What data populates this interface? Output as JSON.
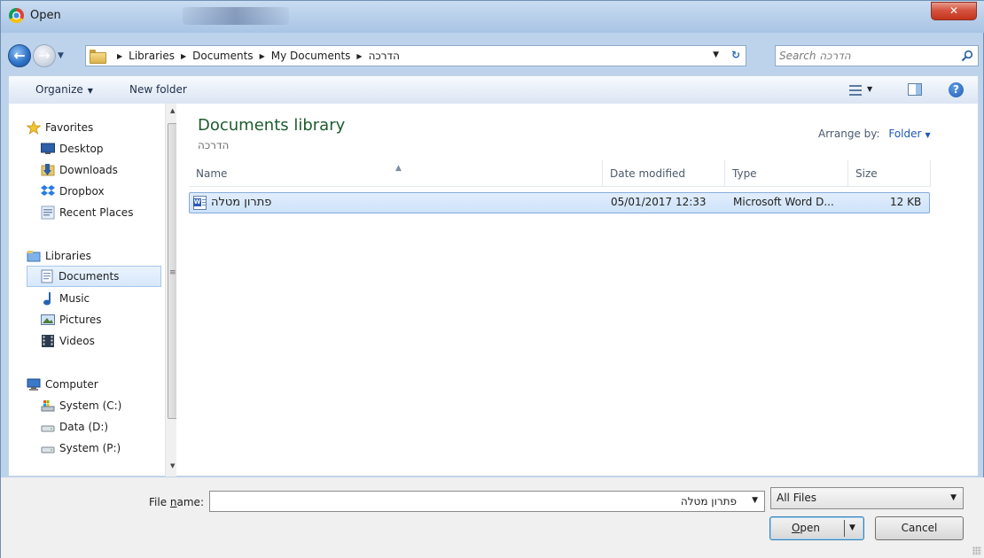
{
  "window": {
    "title": "Open"
  },
  "address": {
    "crumbs": [
      "Libraries",
      "Documents",
      "My Documents",
      "הדרכה"
    ]
  },
  "search": {
    "placeholder": "Search הדרכה"
  },
  "toolbar": {
    "organize_label": "Organize",
    "new_folder_label": "New folder"
  },
  "nav": {
    "favorites": {
      "label": "Favorites",
      "items": [
        "Desktop",
        "Downloads",
        "Dropbox",
        "Recent Places"
      ]
    },
    "libraries": {
      "label": "Libraries",
      "items": [
        "Documents",
        "Music",
        "Pictures",
        "Videos"
      ]
    },
    "computer": {
      "label": "Computer",
      "items": [
        "System (C:)",
        "Data (D:)",
        "System (P:)"
      ]
    },
    "selected": "Documents"
  },
  "library": {
    "title": "Documents library",
    "subtitle": "הדרכה",
    "arrange_label": "Arrange by:",
    "arrange_value": "Folder"
  },
  "columns": [
    "Name",
    "Date modified",
    "Type",
    "Size"
  ],
  "files": [
    {
      "name": "פתרון מטלה",
      "date_modified": "05/01/2017 12:33",
      "type": "Microsoft Word D...",
      "size": "12 KB",
      "icon": "word-document-icon",
      "selected": true
    }
  ],
  "footer": {
    "file_name_label_pre": "File ",
    "file_name_label_accel": "n",
    "file_name_label_post": "ame:",
    "file_name_value": "פתרון מטלה",
    "filter_value": "All Files",
    "open_accel": "O",
    "open_rest": "pen",
    "cancel_label": "Cancel"
  },
  "colors": {
    "accent": "#1f57b4",
    "library_title": "#1e5b2d",
    "selection": "#cde2fb",
    "close": "#c4331d"
  }
}
